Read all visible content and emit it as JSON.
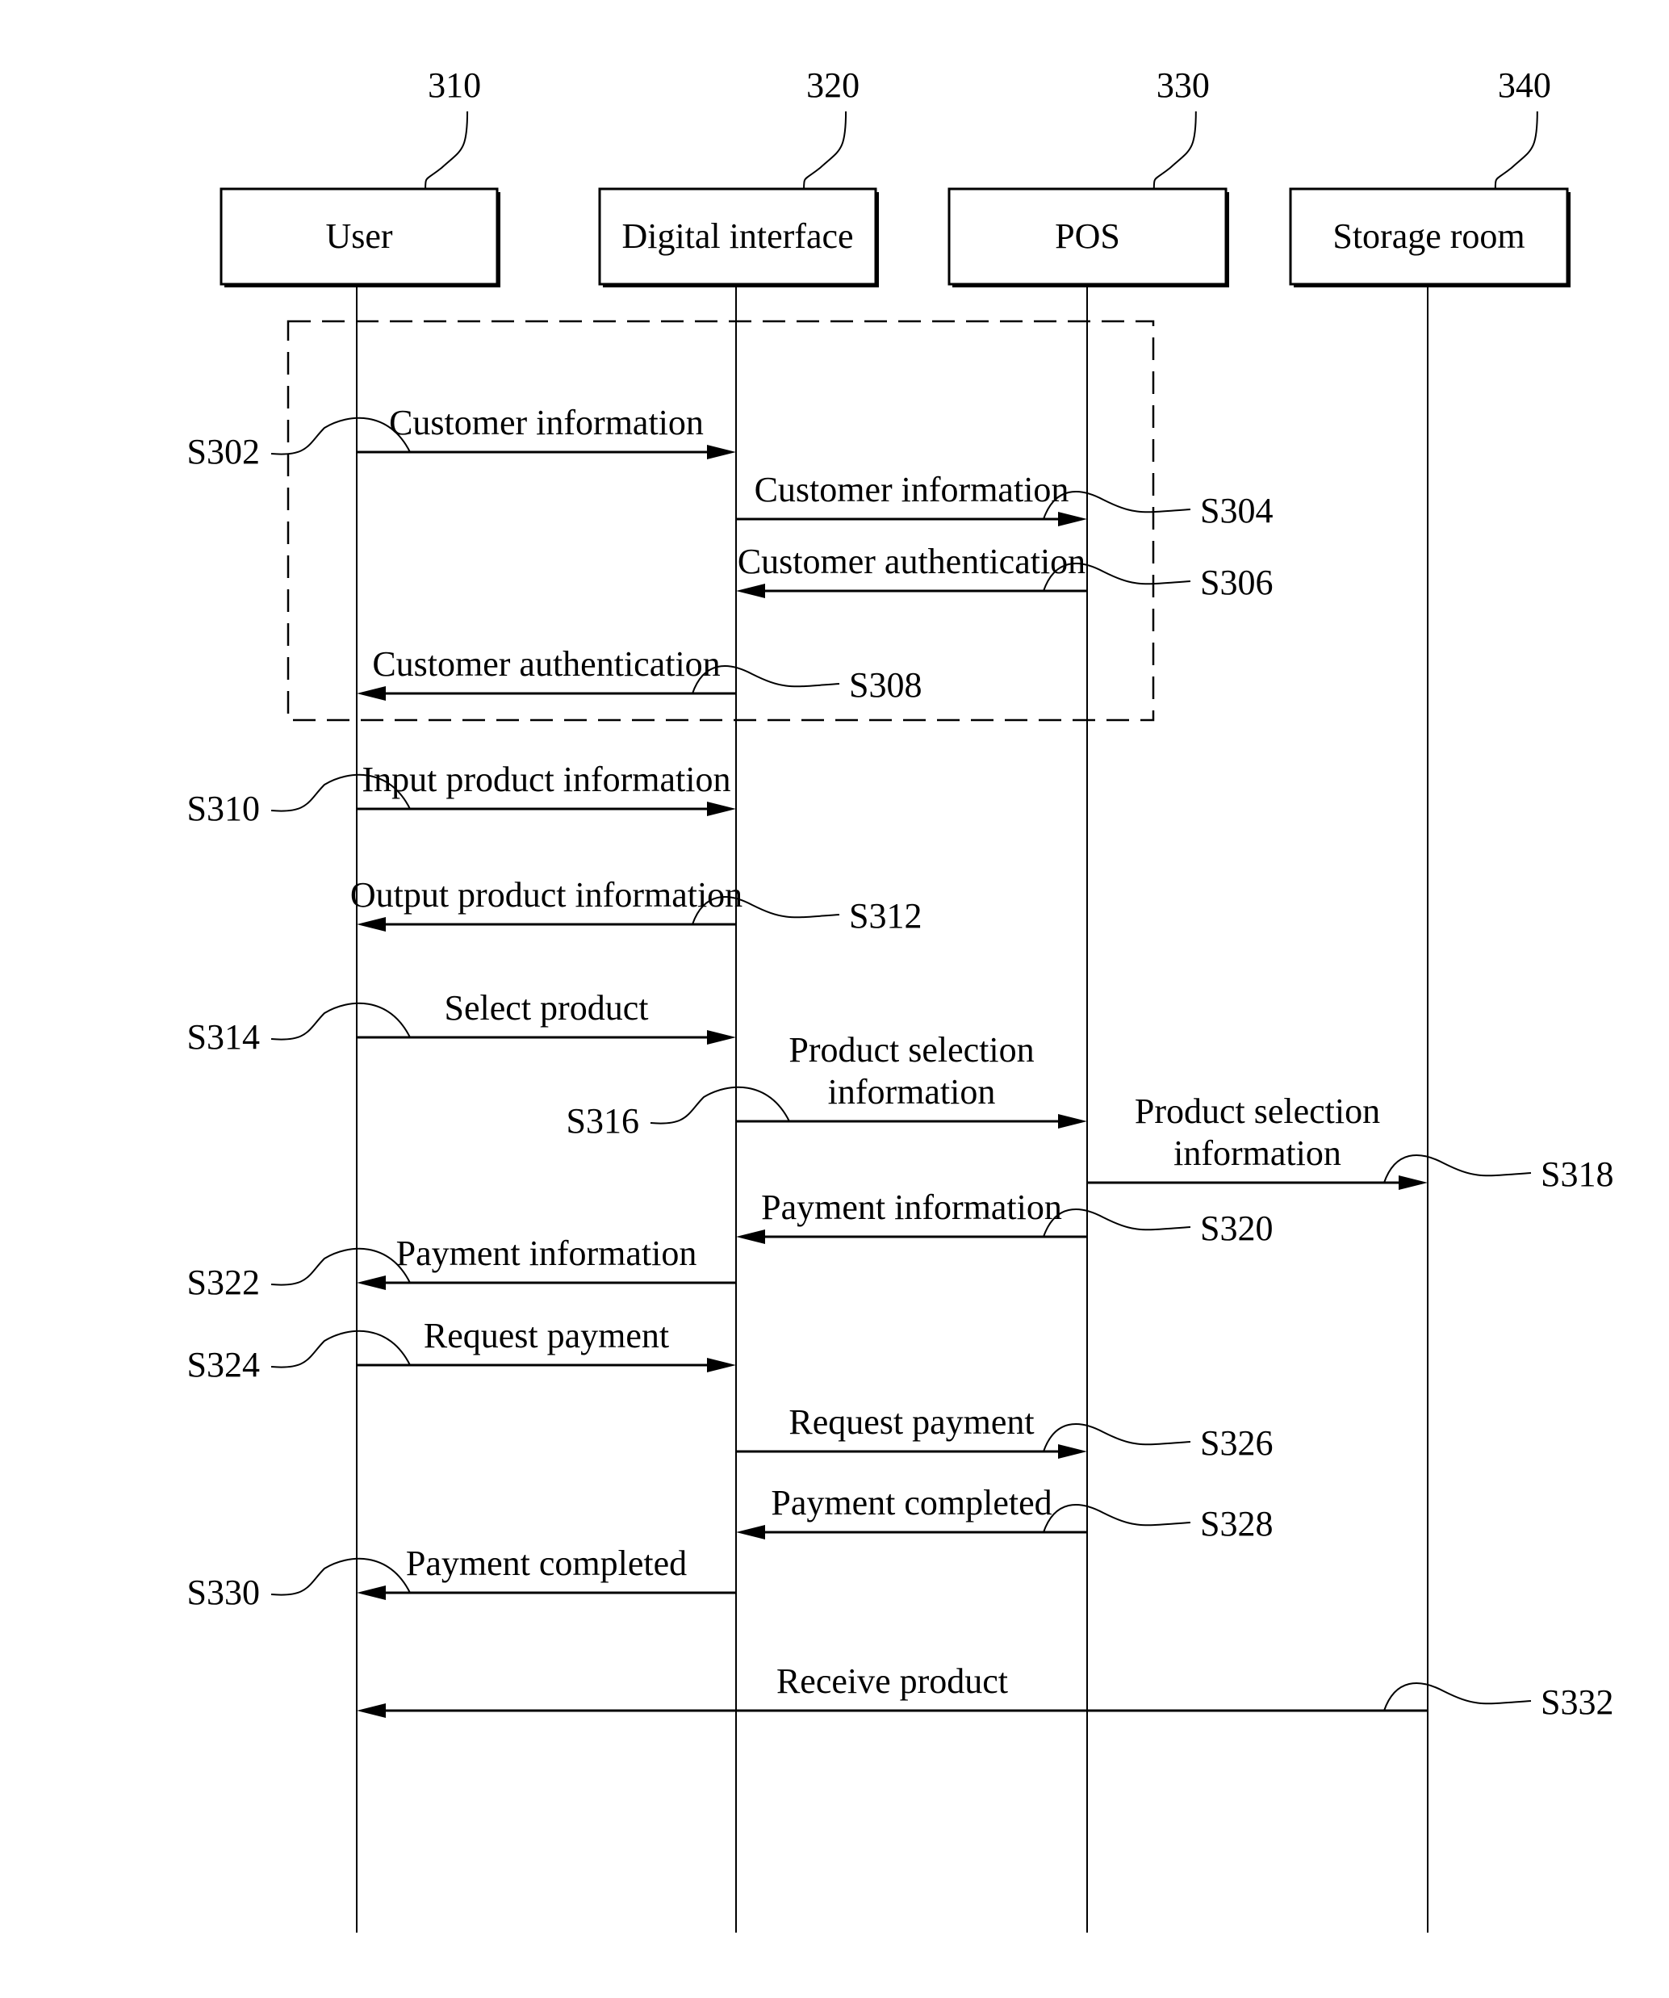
{
  "diagram": {
    "type": "sequence-diagram",
    "participants": [
      {
        "id": "user",
        "label": "User",
        "ref": "310"
      },
      {
        "id": "digital",
        "label": "Digital interface",
        "ref": "320"
      },
      {
        "id": "pos",
        "label": "POS",
        "ref": "330"
      },
      {
        "id": "storage",
        "label": "Storage room",
        "ref": "340"
      }
    ],
    "group": {
      "style": "dashed",
      "covers_steps": [
        "S302",
        "S304",
        "S306",
        "S308"
      ]
    },
    "messages": [
      {
        "step": "S302",
        "from": "user",
        "to": "digital",
        "label": [
          "Customer information"
        ],
        "ref_side": "left"
      },
      {
        "step": "S304",
        "from": "digital",
        "to": "pos",
        "label": [
          "Customer information"
        ],
        "ref_side": "right"
      },
      {
        "step": "S306",
        "from": "pos",
        "to": "digital",
        "label": [
          "Customer authentication"
        ],
        "ref_side": "right"
      },
      {
        "step": "S308",
        "from": "digital",
        "to": "user",
        "label": [
          "Customer authentication"
        ],
        "ref_side": "right"
      },
      {
        "step": "S310",
        "from": "user",
        "to": "digital",
        "label": [
          "Input product information"
        ],
        "ref_side": "left"
      },
      {
        "step": "S312",
        "from": "digital",
        "to": "user",
        "label": [
          "Output product information"
        ],
        "ref_side": "right"
      },
      {
        "step": "S314",
        "from": "user",
        "to": "digital",
        "label": [
          "Select product"
        ],
        "ref_side": "left"
      },
      {
        "step": "S316",
        "from": "digital",
        "to": "pos",
        "label": [
          "Product selection",
          "information"
        ],
        "ref_side": "left"
      },
      {
        "step": "S318",
        "from": "pos",
        "to": "storage",
        "label": [
          "Product selection",
          "information"
        ],
        "ref_side": "right"
      },
      {
        "step": "S320",
        "from": "pos",
        "to": "digital",
        "label": [
          "Payment information"
        ],
        "ref_side": "right"
      },
      {
        "step": "S322",
        "from": "digital",
        "to": "user",
        "label": [
          "Payment information"
        ],
        "ref_side": "left"
      },
      {
        "step": "S324",
        "from": "user",
        "to": "digital",
        "label": [
          "Request payment"
        ],
        "ref_side": "left"
      },
      {
        "step": "S326",
        "from": "digital",
        "to": "pos",
        "label": [
          "Request payment"
        ],
        "ref_side": "right"
      },
      {
        "step": "S328",
        "from": "pos",
        "to": "digital",
        "label": [
          "Payment completed"
        ],
        "ref_side": "right"
      },
      {
        "step": "S330",
        "from": "digital",
        "to": "user",
        "label": [
          "Payment completed"
        ],
        "ref_side": "left"
      },
      {
        "step": "S332",
        "from": "storage",
        "to": "user",
        "label": [
          "Receive product"
        ],
        "ref_side": "right"
      }
    ]
  }
}
